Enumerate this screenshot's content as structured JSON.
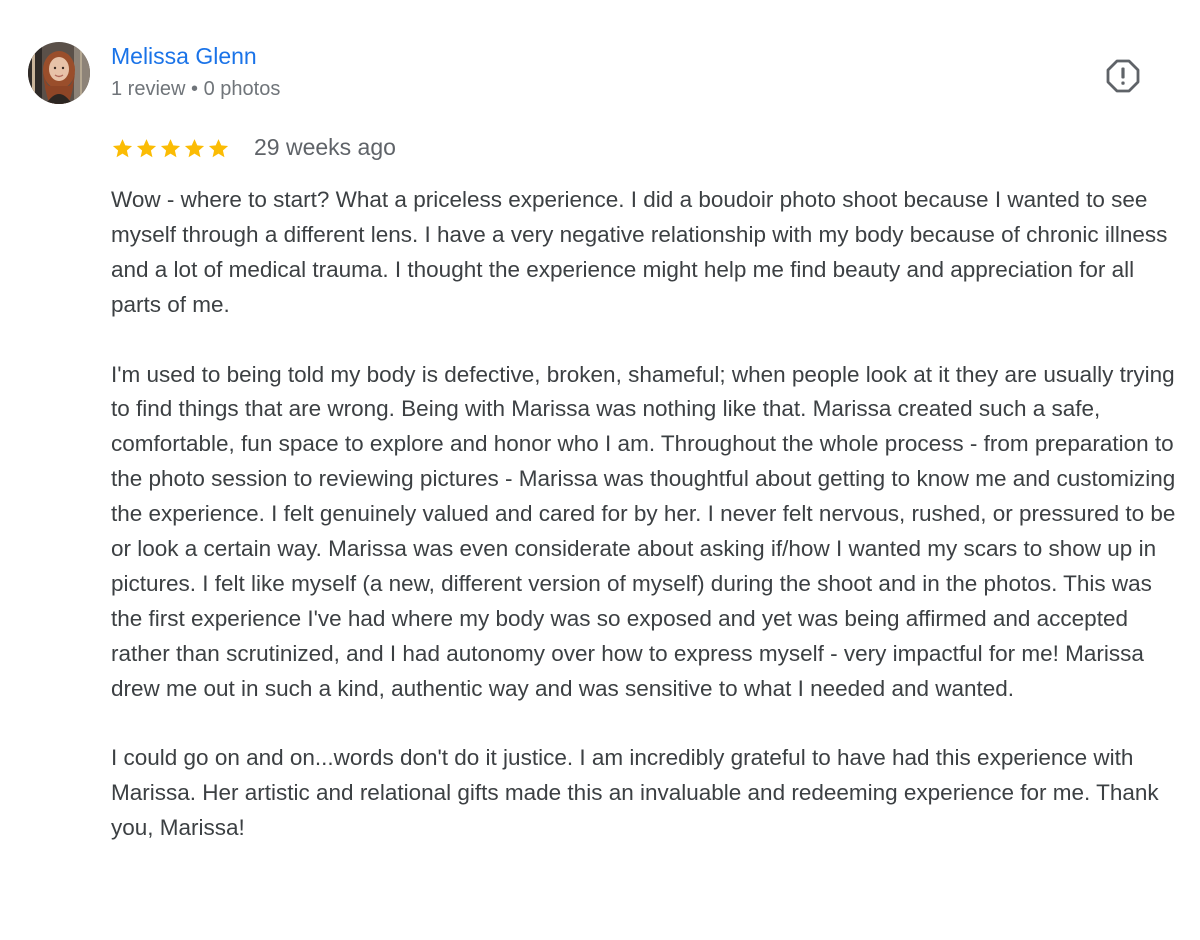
{
  "review": {
    "author": {
      "name": "Melissa Glenn",
      "meta": "1 review • 0 photos",
      "avatar_icon": "avatar-photo"
    },
    "report_icon": "report-flag-icon",
    "rating": {
      "stars": 5,
      "max_stars": 5,
      "star_color": "#fbbc04"
    },
    "date": "29 weeks ago",
    "paragraphs": [
      "Wow - where to start? What a priceless experience. I did a boudoir photo shoot because I wanted to see myself through a different lens. I have a very negative relationship with my body because of chronic illness and a lot of medical trauma. I thought the experience might help me find beauty and appreciation for all parts of me.",
      "I'm used to being told my body is defective, broken, shameful; when people look at it they are usually trying to find things that are wrong. Being with Marissa was nothing like that. Marissa created such a safe, comfortable, fun space to explore and honor who I am. Throughout the whole process - from preparation to the photo session to reviewing pictures - Marissa was thoughtful about getting to know me and customizing the experience. I felt genuinely valued and cared for by her. I never felt nervous, rushed, or pressured to be or look a certain way. Marissa was even considerate about asking if/how I wanted my scars to show up in pictures. I felt like myself (a new, different version of myself) during the shoot and in the photos. This was the first experience I've had where my body was so exposed and yet was being affirmed and accepted rather than scrutinized, and I had autonomy over how to express myself - very impactful for me! Marissa drew me out in such a kind, authentic way and was sensitive to what I needed and wanted.",
      "I could go on and on...words don't do it justice. I am incredibly grateful to have had this experience with Marissa. Her artistic and relational gifts made this an invaluable and redeeming experience for me. Thank you, Marissa!"
    ]
  },
  "colors": {
    "author_link": "#1a73e8",
    "meta_text": "#70757a",
    "body_text": "#3c4043",
    "star": "#fbbc04"
  }
}
